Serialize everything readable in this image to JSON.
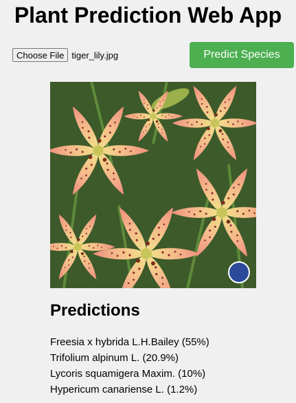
{
  "app": {
    "title": "Plant Prediction Web App"
  },
  "upload": {
    "button_label": "Choose File",
    "file_name": "tiger_lily.jpg"
  },
  "predict": {
    "button_label": "Predict Species",
    "color": "#4caf50"
  },
  "image": {
    "subject": "lily flowers photo"
  },
  "predictions": {
    "heading": "Predictions",
    "items": [
      "Freesia x hybrida L.H.Bailey (55%)",
      "Trifolium alpinum L. (20.9%)",
      "Lycoris squamigera Maxim. (10%)",
      "Hypericum canariense L. (1.2%)"
    ]
  }
}
